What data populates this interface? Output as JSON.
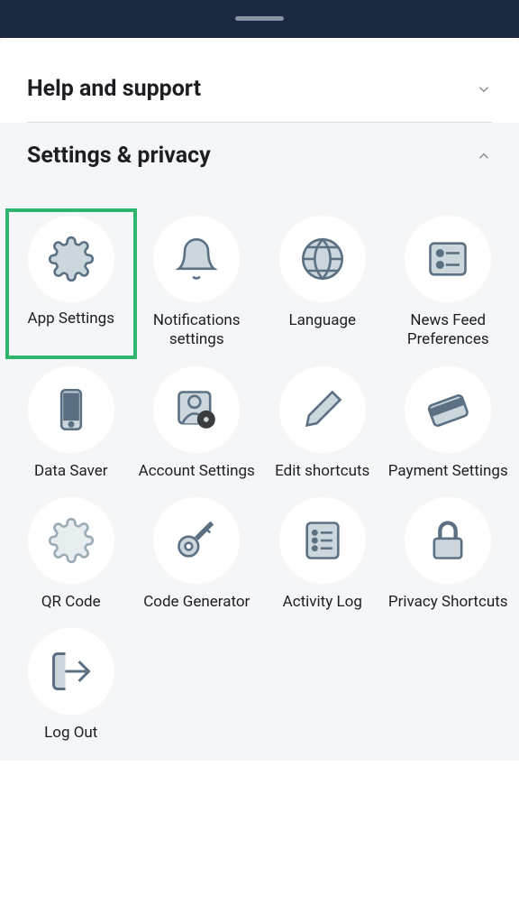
{
  "sections": {
    "help": {
      "title": "Help and support",
      "expanded": false
    },
    "settings": {
      "title": "Settings & privacy",
      "expanded": true,
      "items": [
        {
          "label": "App Settings",
          "highlighted": true
        },
        {
          "label": "Notifications settings"
        },
        {
          "label": "Language"
        },
        {
          "label": "News Feed Preferences"
        },
        {
          "label": "Data Saver"
        },
        {
          "label": "Account Settings"
        },
        {
          "label": "Edit shortcuts"
        },
        {
          "label": "Payment Settings"
        },
        {
          "label": "QR Code"
        },
        {
          "label": "Code Generator"
        },
        {
          "label": "Activity Log"
        },
        {
          "label": "Privacy Shortcuts"
        },
        {
          "label": "Log Out"
        }
      ]
    }
  }
}
